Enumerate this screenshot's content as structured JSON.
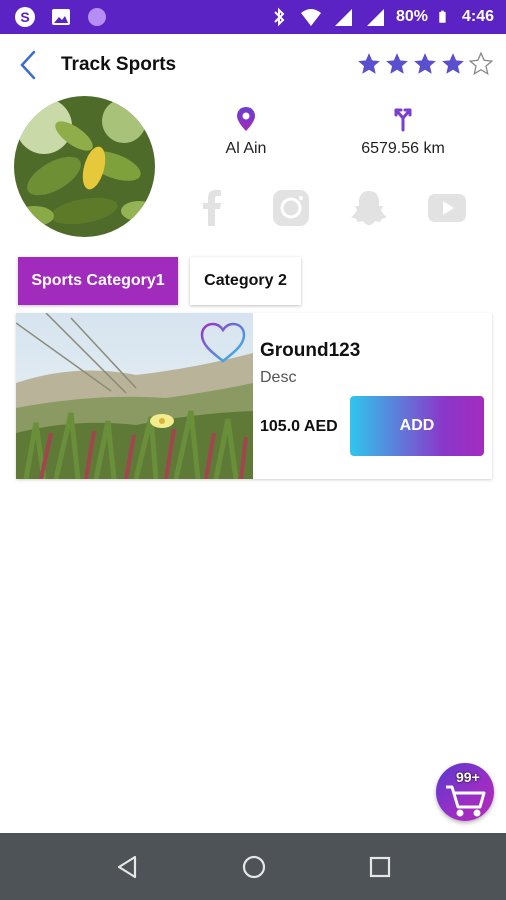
{
  "status_bar": {
    "battery_percent": "80%",
    "time": "4:46",
    "bg_color": "#5b22c4"
  },
  "header": {
    "title": "Track Sports",
    "rating": {
      "value": 4,
      "max": 5,
      "star_color": "#5a4fcf"
    }
  },
  "profile": {
    "city": "Al Ain",
    "distance": "6579.56 km",
    "social_icons": [
      "facebook-icon",
      "instagram-icon",
      "snapchat-icon",
      "youtube-icon"
    ]
  },
  "tabs": [
    {
      "label": "Sports Category1",
      "active": true
    },
    {
      "label": "Category 2",
      "active": false
    }
  ],
  "items": [
    {
      "name": "Ground123",
      "desc": "Desc",
      "price": "105.0 AED",
      "add_label": "ADD"
    }
  ],
  "cart": {
    "badge": "99+"
  },
  "colors": {
    "accent_purple": "#a12bbd",
    "gradient_start": "#2fc6ec",
    "gradient_end": "#a32cc0"
  }
}
